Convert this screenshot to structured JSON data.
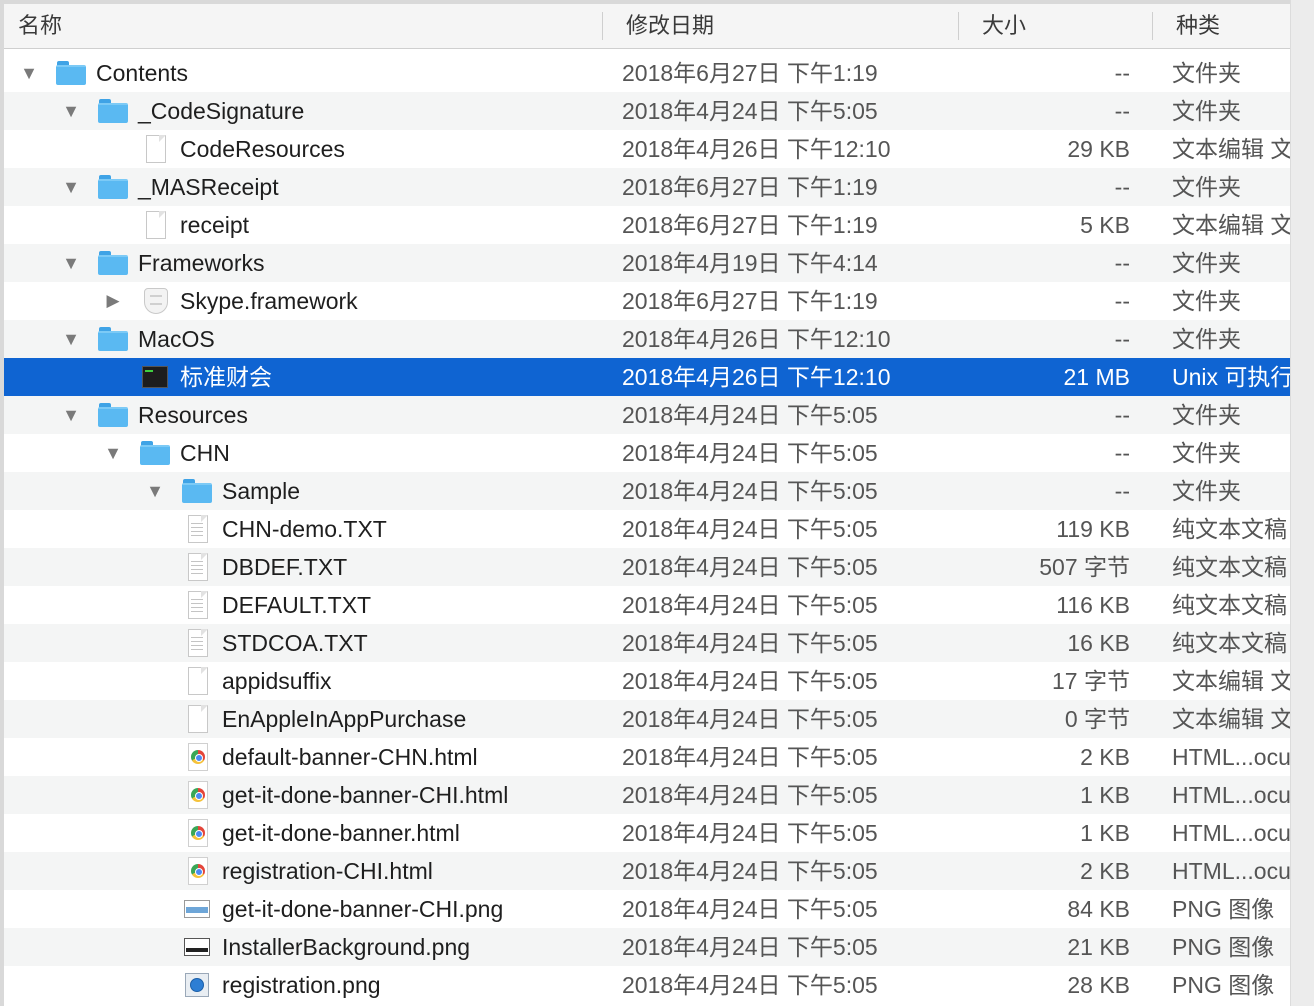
{
  "columns": {
    "name": "名称",
    "date": "修改日期",
    "size": "大小",
    "kind": "种类"
  },
  "rows": [
    {
      "name": "Contents",
      "date": "2018年6月27日 下午1:19",
      "size": "--",
      "kind": "文件夹",
      "level": 0,
      "disclosure": "expanded",
      "icon": "folder-icon"
    },
    {
      "name": "_CodeSignature",
      "date": "2018年4月24日 下午5:05",
      "size": "--",
      "kind": "文件夹",
      "level": 1,
      "disclosure": "expanded",
      "icon": "folder-icon"
    },
    {
      "name": "CodeResources",
      "date": "2018年4月26日 下午12:10",
      "size": "29 KB",
      "kind": "文本编辑 文",
      "level": 2,
      "disclosure": "none",
      "icon": "document-icon"
    },
    {
      "name": "_MASReceipt",
      "date": "2018年6月27日 下午1:19",
      "size": "--",
      "kind": "文件夹",
      "level": 1,
      "disclosure": "expanded",
      "icon": "folder-icon"
    },
    {
      "name": "receipt",
      "date": "2018年6月27日 下午1:19",
      "size": "5 KB",
      "kind": "文本编辑 文",
      "level": 2,
      "disclosure": "none",
      "icon": "document-icon"
    },
    {
      "name": "Frameworks",
      "date": "2018年4月19日 下午4:14",
      "size": "--",
      "kind": "文件夹",
      "level": 1,
      "disclosure": "expanded",
      "icon": "folder-icon"
    },
    {
      "name": "Skype.framework",
      "date": "2018年6月27日 下午1:19",
      "size": "--",
      "kind": "文件夹",
      "level": 2,
      "disclosure": "collapsed",
      "icon": "bundle-icon"
    },
    {
      "name": "MacOS",
      "date": "2018年4月26日 下午12:10",
      "size": "--",
      "kind": "文件夹",
      "level": 1,
      "disclosure": "expanded",
      "icon": "folder-icon"
    },
    {
      "name": "标准财会",
      "date": "2018年4月26日 下午12:10",
      "size": "21 MB",
      "kind": "Unix 可执行",
      "level": 2,
      "disclosure": "none",
      "icon": "terminal-icon",
      "selected": true
    },
    {
      "name": "Resources",
      "date": "2018年4月24日 下午5:05",
      "size": "--",
      "kind": "文件夹",
      "level": 1,
      "disclosure": "expanded",
      "icon": "folder-icon"
    },
    {
      "name": "CHN",
      "date": "2018年4月24日 下午5:05",
      "size": "--",
      "kind": "文件夹",
      "level": 2,
      "disclosure": "expanded",
      "icon": "folder-icon"
    },
    {
      "name": "Sample",
      "date": "2018年4月24日 下午5:05",
      "size": "--",
      "kind": "文件夹",
      "level": 3,
      "disclosure": "expanded",
      "icon": "folder-icon"
    },
    {
      "name": "CHN-demo.TXT",
      "date": "2018年4月24日 下午5:05",
      "size": "119 KB",
      "kind": "纯文本文稿",
      "level": 3,
      "disclosure": "none",
      "icon": "text-document-icon"
    },
    {
      "name": "DBDEF.TXT",
      "date": "2018年4月24日 下午5:05",
      "size": "507 字节",
      "kind": "纯文本文稿",
      "level": 3,
      "disclosure": "none",
      "icon": "text-document-icon"
    },
    {
      "name": "DEFAULT.TXT",
      "date": "2018年4月24日 下午5:05",
      "size": "116 KB",
      "kind": "纯文本文稿",
      "level": 3,
      "disclosure": "none",
      "icon": "text-document-icon"
    },
    {
      "name": "STDCOA.TXT",
      "date": "2018年4月24日 下午5:05",
      "size": "16 KB",
      "kind": "纯文本文稿",
      "level": 3,
      "disclosure": "none",
      "icon": "text-document-icon"
    },
    {
      "name": "appidsuffix",
      "date": "2018年4月24日 下午5:05",
      "size": "17 字节",
      "kind": "文本编辑 文",
      "level": 3,
      "disclosure": "none",
      "icon": "document-icon"
    },
    {
      "name": "EnAppleInAppPurchase",
      "date": "2018年4月24日 下午5:05",
      "size": "0 字节",
      "kind": "文本编辑 文",
      "level": 3,
      "disclosure": "none",
      "icon": "document-icon"
    },
    {
      "name": "default-banner-CHN.html",
      "date": "2018年4月24日 下午5:05",
      "size": "2 KB",
      "kind": "HTML...ocu",
      "level": 3,
      "disclosure": "none",
      "icon": "chrome-html-icon"
    },
    {
      "name": "get-it-done-banner-CHI.html",
      "date": "2018年4月24日 下午5:05",
      "size": "1 KB",
      "kind": "HTML...ocu",
      "level": 3,
      "disclosure": "none",
      "icon": "chrome-html-icon"
    },
    {
      "name": "get-it-done-banner.html",
      "date": "2018年4月24日 下午5:05",
      "size": "1 KB",
      "kind": "HTML...ocu",
      "level": 3,
      "disclosure": "none",
      "icon": "chrome-html-icon"
    },
    {
      "name": "registration-CHI.html",
      "date": "2018年4月24日 下午5:05",
      "size": "2 KB",
      "kind": "HTML...ocu",
      "level": 3,
      "disclosure": "none",
      "icon": "chrome-html-icon"
    },
    {
      "name": "get-it-done-banner-CHI.png",
      "date": "2018年4月24日 下午5:05",
      "size": "84 KB",
      "kind": "PNG 图像",
      "level": 3,
      "disclosure": "none",
      "icon": "png-banner-icon"
    },
    {
      "name": "InstallerBackground.png",
      "date": "2018年4月24日 下午5:05",
      "size": "21 KB",
      "kind": "PNG 图像",
      "level": 3,
      "disclosure": "none",
      "icon": "png-installer-icon"
    },
    {
      "name": "registration.png",
      "date": "2018年4月24日 下午5:05",
      "size": "28 KB",
      "kind": "PNG 图像",
      "level": 3,
      "disclosure": "none",
      "icon": "png-globe-icon"
    }
  ]
}
